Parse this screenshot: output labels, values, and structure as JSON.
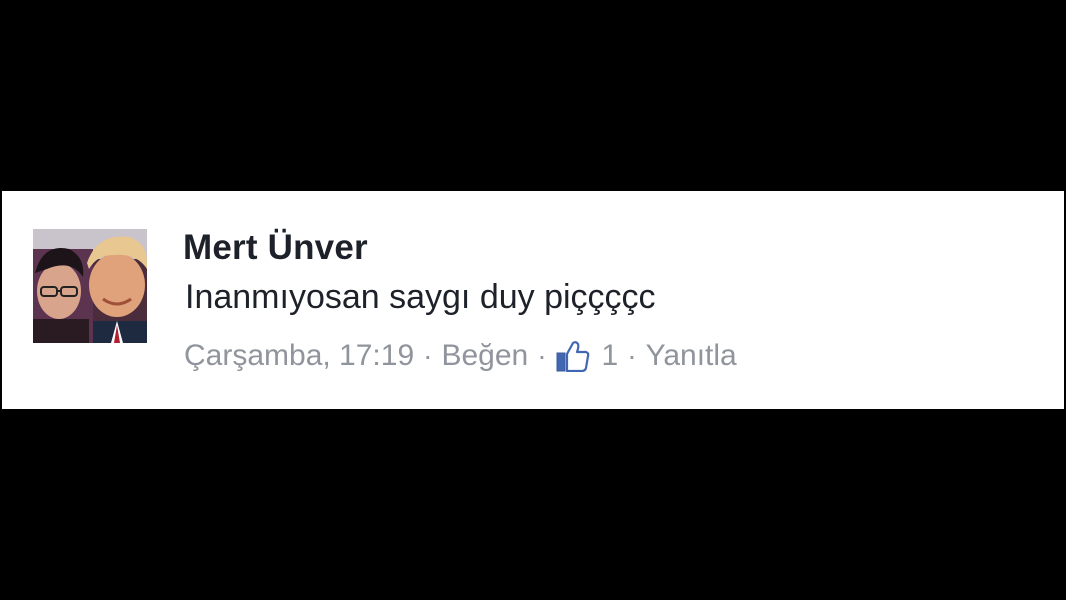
{
  "comment": {
    "author_name": "Mert Ünver",
    "text": "Inanmıyosan saygı duy piççççc",
    "timestamp": "Çarşamba, 17:19",
    "like_action_label": "Beğen",
    "like_count": "1",
    "reply_action_label": "Yanıtla",
    "separator": "·",
    "avatar_icon": "profile-photo",
    "like_icon": "thumbs-up-icon"
  },
  "colors": {
    "background": "#000000",
    "card": "#ffffff",
    "author_text": "#1d2129",
    "meta_text": "#90949c",
    "like_icon": "#4267b2"
  }
}
